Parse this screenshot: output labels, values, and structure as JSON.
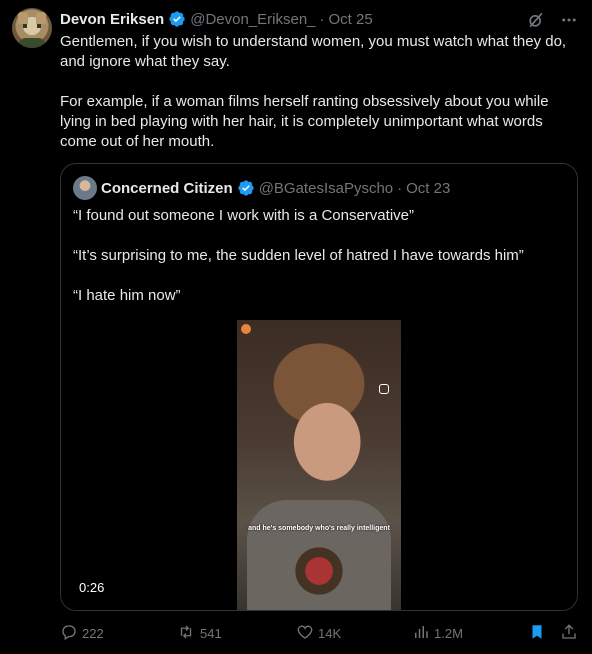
{
  "author": {
    "name": "Devon Eriksen",
    "handle": "@Devon_Eriksen_",
    "separator": "·",
    "time": "Oct 25"
  },
  "tweet": {
    "paragraph1": "Gentlemen, if you wish to understand women, you must watch what they do, and ignore what they say.",
    "paragraph2": "For example, if a woman films herself ranting obsessively about you while lying in bed playing with her hair, it is completely unimportant what words come out of her mouth."
  },
  "quote": {
    "name": "Concerned Citizen",
    "handle": "@BGatesIsaPyscho",
    "separator": "·",
    "time": "Oct 23",
    "lines": [
      "“I found out someone I work with is a Conservative”",
      "“It’s surprising to me, the sudden level of hatred I have towards him”",
      "“I hate him now”"
    ],
    "video": {
      "duration": "0:26",
      "caption": "and he's somebody who's really intelligent"
    }
  },
  "actions": {
    "replies": "222",
    "reposts": "541",
    "likes": "14K",
    "views": "1.2M"
  },
  "icons": {
    "verified": "verified-badge-icon",
    "grok": "grok-icon",
    "more": "more-icon",
    "reply": "reply-icon",
    "repost": "repost-icon",
    "like": "heart-icon",
    "views": "views-icon",
    "bookmark": "bookmark-icon",
    "share": "share-icon"
  },
  "colors": {
    "background": "#000000",
    "text": "#e7e9ea",
    "muted": "#71767b",
    "accent": "#1d9bf0",
    "border": "#2f3336"
  }
}
